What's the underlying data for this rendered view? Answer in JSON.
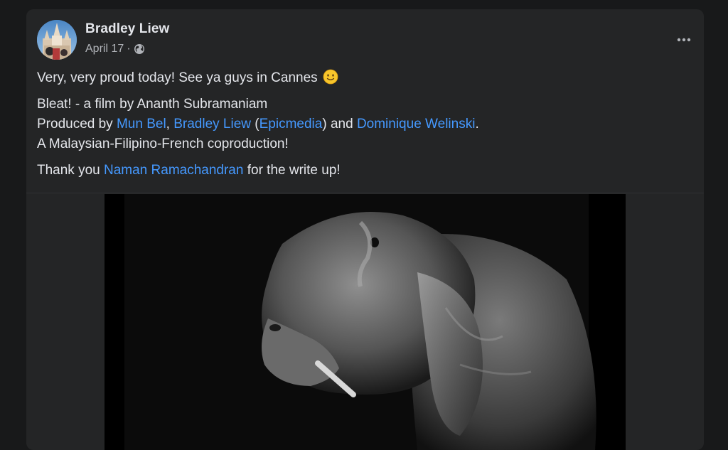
{
  "post": {
    "author": "Bradley Liew",
    "date": "April 17",
    "separator": "·",
    "line1": "Very, very proud today! See ya guys in Cannes",
    "line2": "Bleat! - a film by Ananth Subramaniam",
    "line3_prefix": "Produced by ",
    "link_mun_bel": "Mun Bel",
    "comma": ", ",
    "link_bradley": "Bradley Liew",
    "paren_open": " (",
    "link_epicmedia": "Epicmedia",
    "paren_close_and": ") and ",
    "link_dominique": "Dominique Welinski",
    "period": ".",
    "line4": "A Malaysian-Filipino-French coproduction!",
    "line5_prefix": "Thank you ",
    "link_naman": "Naman Ramachandran",
    "line5_suffix": " for the write up!"
  },
  "icons": {
    "privacy": "globe-icon",
    "more": "more-horizontal-icon",
    "emoji": "slightly-smiling-face-emoji"
  },
  "colors": {
    "background": "#18191a",
    "card": "#242526",
    "text": "#e4e6eb",
    "secondary_text": "#b0b3b8",
    "link": "#4599ff"
  }
}
